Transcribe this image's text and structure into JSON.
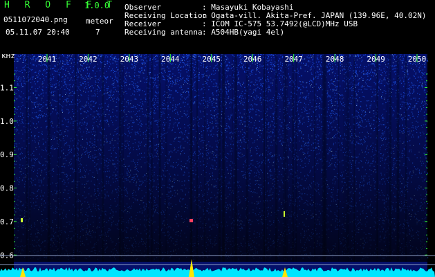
{
  "app": {
    "name": "H R O F F T",
    "version": "1.0.0",
    "filename": "0511072040.png",
    "datetime": "05.11.07 20:40",
    "meteor_label": "meteor",
    "meteor_count": "7"
  },
  "info": [
    {
      "label": "Observer",
      "value": ": Masayuki Kobayashi"
    },
    {
      "label": "Receiving Location",
      "value": ": Ogata-vill. Akita-Pref. JAPAN (139.96E, 40.02N)"
    },
    {
      "label": "Receiver",
      "value": ": ICOM IC-575 53.7492(@LCD)MHz USB"
    },
    {
      "label": "Receiving antenna",
      "value": ": A504HB(yagi 4el)"
    }
  ],
  "spectrogram": {
    "y_unit": "kHz",
    "y_ticks": [
      "1.1",
      "1.0",
      "0.9",
      "0.8",
      "0.7",
      "0.6"
    ],
    "y_tick_values": [
      1.1,
      1.0,
      0.9,
      0.8,
      0.7,
      0.6
    ],
    "y_range": [
      0.58,
      1.2
    ],
    "time_ticks": [
      "2041",
      "2042",
      "2043",
      "2044",
      "2045",
      "2046",
      "2047",
      "2048",
      "2049",
      "2050"
    ],
    "colors": {
      "background": "#05106a",
      "noise": "#1f5cff",
      "text": "#ffffff",
      "tick": "#36ff36",
      "signal": "#00e5ff",
      "peak": "#ffe600"
    }
  }
}
